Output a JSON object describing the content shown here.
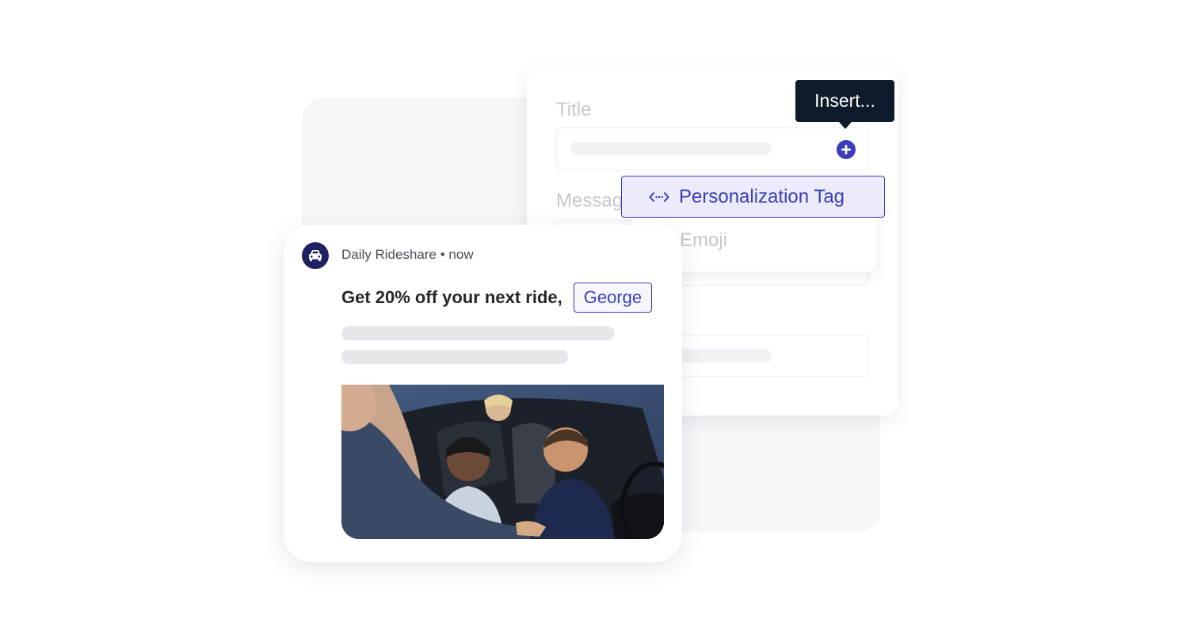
{
  "editor": {
    "title_label": "Title",
    "message_label": "Messag",
    "insert_tooltip": "Insert..."
  },
  "insert_menu": {
    "items": [
      {
        "label": "Personalization Tag",
        "icon": "code-tag-icon",
        "active": true
      },
      {
        "label": "Emoji",
        "icon": "smiley-icon",
        "active": false
      }
    ]
  },
  "notification": {
    "app_icon": "car-icon",
    "app_name": "Daily Rideshare",
    "separator": "•",
    "time": "now",
    "title": "Get 20% off your next ride,",
    "personalization_value": "George",
    "image_icon": "car-interior-photo"
  },
  "colors": {
    "accent": "#3d3dbb",
    "tooltip_bg": "#0e1b2a",
    "app_icon_bg": "#1f2160",
    "active_item_bg": "#ebebfb"
  }
}
